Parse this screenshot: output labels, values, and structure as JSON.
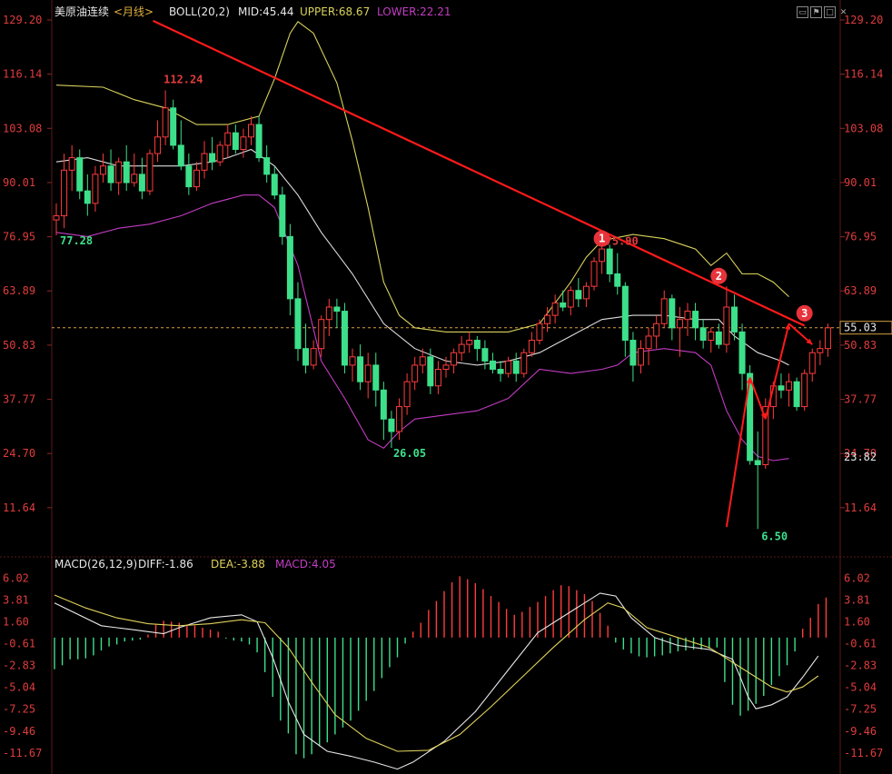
{
  "header": {
    "symbol": "美原油连续",
    "period": "<月线>",
    "boll_label": "BOLL(20,2)",
    "mid_label": "MID:45.44",
    "upper_label": "UPPER:68.67",
    "lower_label": "LOWER:22.21",
    "macd_label": "MACD(26,12,9)",
    "diff_label": "DIFF:-1.86",
    "dea_label": "DEA:-3.88",
    "macd_val_label": "MACD:4.05"
  },
  "toolbar": {
    "icons": [
      "restore-icon",
      "flag-icon",
      "maximize-icon",
      "close-icon"
    ]
  },
  "colors": {
    "up": "#ff3c3c",
    "down": "#3de08a",
    "axis_text": "#e03c3c",
    "price_text": "#e8e8e8",
    "boll_upper": "#d8d25a",
    "boll_mid": "#dcdcdc",
    "boll_lower": "#c33cc3",
    "trend": "#ff1a1a",
    "diff": "#e8e8e8",
    "dea": "#e0d25a",
    "dashed": "#d8a040"
  },
  "chart_data": {
    "type": "candlestick",
    "price_axis": {
      "ticks": [
        "129.20",
        "116.14",
        "103.08",
        "90.01",
        "76.95",
        "63.89",
        "50.83",
        "37.77",
        "24.70",
        "11.64"
      ],
      "ylim": [
        0,
        129.2
      ]
    },
    "macd_axis": {
      "ticks": [
        "6.02",
        "3.81",
        "1.60",
        "-0.61",
        "-2.83",
        "-5.04",
        "-7.25",
        "-9.46",
        "-11.67"
      ],
      "ylim": [
        -13.8,
        6.6
      ]
    },
    "current_price": "55.03",
    "current_value": 55.03,
    "lower_band_value": "23.82",
    "lower_value": 23.82,
    "annotations": {
      "high_1": "112.24",
      "low_1": "77.28",
      "low_2": "26.05",
      "high_2": "75.90",
      "low_3": "6.50"
    },
    "markers": [
      "1",
      "2",
      "3"
    ],
    "candles": [
      [
        81,
        85,
        77.3,
        82
      ],
      [
        82,
        97,
        79,
        93
      ],
      [
        93,
        99,
        88,
        96
      ],
      [
        96,
        98,
        86,
        88
      ],
      [
        88,
        92,
        82,
        85
      ],
      [
        85,
        94,
        83,
        92
      ],
      [
        92,
        97,
        90,
        94
      ],
      [
        94,
        98,
        88,
        90
      ],
      [
        90,
        96,
        87,
        95
      ],
      [
        95,
        99,
        88,
        90
      ],
      [
        90,
        97,
        89,
        92
      ],
      [
        92,
        96,
        86,
        88
      ],
      [
        88,
        98,
        87,
        97
      ],
      [
        97,
        105,
        95,
        101
      ],
      [
        101,
        112.24,
        99,
        108
      ],
      [
        108,
        110,
        98,
        99
      ],
      [
        99,
        105,
        93,
        94
      ],
      [
        94,
        97,
        87,
        89
      ],
      [
        89,
        95,
        88,
        93
      ],
      [
        93,
        100,
        91,
        97
      ],
      [
        97,
        101,
        93,
        95
      ],
      [
        95,
        100,
        94,
        99
      ],
      [
        99,
        104,
        96,
        102
      ],
      [
        102,
        104,
        97,
        98
      ],
      [
        98,
        103,
        96,
        101
      ],
      [
        101,
        106,
        99,
        104
      ],
      [
        104,
        106,
        95,
        96
      ],
      [
        96,
        99,
        90,
        92
      ],
      [
        92,
        94,
        86,
        87
      ],
      [
        87,
        89,
        75,
        77
      ],
      [
        77,
        80,
        58,
        62
      ],
      [
        62,
        66,
        47,
        50
      ],
      [
        50,
        56,
        44,
        46
      ],
      [
        46,
        52,
        45,
        50
      ],
      [
        50,
        58,
        48,
        57
      ],
      [
        57,
        62,
        53,
        60
      ],
      [
        60,
        62,
        55,
        59
      ],
      [
        59,
        61,
        44,
        46
      ],
      [
        46,
        50,
        42,
        48
      ],
      [
        48,
        51,
        40,
        42
      ],
      [
        42,
        49,
        38,
        46
      ],
      [
        46,
        49,
        36,
        40
      ],
      [
        40,
        42,
        28,
        33
      ],
      [
        33,
        35,
        26.05,
        30
      ],
      [
        30,
        38,
        28,
        36
      ],
      [
        36,
        44,
        34,
        42
      ],
      [
        42,
        48,
        40,
        46
      ],
      [
        46,
        50,
        44,
        48
      ],
      [
        48,
        50,
        39,
        41
      ],
      [
        41,
        47,
        39,
        45
      ],
      [
        45,
        48,
        43,
        46
      ],
      [
        46,
        50,
        44,
        49
      ],
      [
        49,
        53,
        47,
        51
      ],
      [
        51,
        54,
        49,
        52
      ],
      [
        52,
        53,
        47,
        50
      ],
      [
        50,
        52,
        45,
        47
      ],
      [
        47,
        49,
        44,
        45
      ],
      [
        45,
        47,
        42,
        44
      ],
      [
        44,
        48,
        43,
        47
      ],
      [
        47,
        49,
        42,
        44
      ],
      [
        44,
        50,
        43,
        49
      ],
      [
        49,
        54,
        48,
        52
      ],
      [
        52,
        57,
        51,
        56
      ],
      [
        56,
        60,
        54,
        58
      ],
      [
        58,
        63,
        56,
        61
      ],
      [
        61,
        64,
        59,
        60
      ],
      [
        60,
        65,
        58,
        64
      ],
      [
        64,
        67,
        60,
        62
      ],
      [
        62,
        66,
        60,
        65
      ],
      [
        65,
        72,
        64,
        71
      ],
      [
        71,
        75.9,
        68,
        74
      ],
      [
        74,
        75,
        66,
        68
      ],
      [
        68,
        73,
        63,
        65
      ],
      [
        65,
        66,
        48,
        52
      ],
      [
        52,
        54,
        42,
        46
      ],
      [
        46,
        52,
        44,
        50
      ],
      [
        50,
        55,
        46,
        53
      ],
      [
        53,
        58,
        50,
        56
      ],
      [
        56,
        64,
        55,
        62
      ],
      [
        62,
        63,
        52,
        55
      ],
      [
        55,
        60,
        48,
        57
      ],
      [
        57,
        61,
        53,
        59
      ],
      [
        59,
        61,
        52,
        55
      ],
      [
        55,
        57,
        50,
        52
      ],
      [
        52,
        55,
        49,
        54
      ],
      [
        54,
        56,
        50,
        51
      ],
      [
        51,
        65,
        49,
        60
      ],
      [
        60,
        63,
        52,
        54
      ],
      [
        54,
        56,
        40,
        44
      ],
      [
        44,
        46,
        22,
        23
      ],
      [
        23,
        30,
        6.5,
        22
      ],
      [
        22,
        38,
        21,
        36
      ],
      [
        36,
        42,
        33,
        41
      ],
      [
        41,
        44,
        38,
        40
      ],
      [
        40,
        44,
        36,
        42
      ],
      [
        42,
        43,
        35,
        36
      ],
      [
        36,
        45,
        35,
        44
      ],
      [
        44,
        50,
        42,
        49
      ],
      [
        49,
        52,
        46,
        50
      ],
      [
        50,
        56,
        48,
        55
      ]
    ],
    "boll": {
      "upper": [
        [
          0,
          113.5
        ],
        [
          6,
          113
        ],
        [
          10,
          110
        ],
        [
          14,
          108
        ],
        [
          18,
          104
        ],
        [
          22,
          104
        ],
        [
          26,
          106
        ],
        [
          28,
          115
        ],
        [
          30,
          126
        ],
        [
          31,
          128.8
        ],
        [
          33,
          126
        ],
        [
          36,
          114
        ],
        [
          38,
          100
        ],
        [
          40,
          84
        ],
        [
          42,
          66
        ],
        [
          44,
          58
        ],
        [
          46,
          55
        ],
        [
          50,
          54
        ],
        [
          54,
          54
        ],
        [
          58,
          54
        ],
        [
          62,
          56
        ],
        [
          66,
          66
        ],
        [
          68,
          72
        ],
        [
          70,
          76
        ],
        [
          74,
          77.5
        ],
        [
          78,
          76.5
        ],
        [
          82,
          74
        ],
        [
          84,
          70
        ],
        [
          86,
          73
        ],
        [
          88,
          68
        ],
        [
          90,
          68
        ],
        [
          92,
          66
        ],
        [
          94,
          62.5
        ]
      ],
      "mid": [
        [
          0,
          95
        ],
        [
          4,
          96
        ],
        [
          8,
          94
        ],
        [
          12,
          94
        ],
        [
          16,
          94
        ],
        [
          20,
          95
        ],
        [
          22,
          96
        ],
        [
          25,
          98
        ],
        [
          28,
          94
        ],
        [
          31,
          87
        ],
        [
          34,
          78
        ],
        [
          38,
          68
        ],
        [
          42,
          56
        ],
        [
          46,
          50
        ],
        [
          50,
          47
        ],
        [
          54,
          46
        ],
        [
          58,
          47
        ],
        [
          62,
          49
        ],
        [
          66,
          53
        ],
        [
          70,
          57
        ],
        [
          74,
          58
        ],
        [
          78,
          58
        ],
        [
          82,
          57
        ],
        [
          85,
          57
        ],
        [
          87,
          53
        ],
        [
          90,
          49
        ],
        [
          93,
          47
        ],
        [
          94,
          46
        ]
      ],
      "lower": [
        [
          0,
          78
        ],
        [
          4,
          77
        ],
        [
          8,
          79
        ],
        [
          12,
          80
        ],
        [
          16,
          82
        ],
        [
          20,
          85
        ],
        [
          24,
          87
        ],
        [
          26,
          87
        ],
        [
          28,
          84
        ],
        [
          31,
          70
        ],
        [
          34,
          47
        ],
        [
          37,
          38
        ],
        [
          40,
          28
        ],
        [
          42,
          26
        ],
        [
          44,
          30
        ],
        [
          46,
          33
        ],
        [
          50,
          34
        ],
        [
          54,
          35
        ],
        [
          58,
          38
        ],
        [
          62,
          45
        ],
        [
          66,
          44
        ],
        [
          70,
          45
        ],
        [
          72,
          46
        ],
        [
          74,
          49
        ],
        [
          78,
          50
        ],
        [
          82,
          49
        ],
        [
          84,
          46
        ],
        [
          86,
          35
        ],
        [
          88,
          28
        ],
        [
          90,
          24
        ],
        [
          92,
          23
        ],
        [
          94,
          23.5
        ]
      ]
    },
    "trendline": [
      [
        6,
        129
      ],
      [
        96,
        55.5
      ]
    ],
    "arrows": [
      [
        [
          86,
          7
        ],
        [
          89,
          43
        ]
      ],
      [
        [
          89,
          43
        ],
        [
          91,
          33
        ]
      ],
      [
        [
          91,
          33
        ],
        [
          94,
          56
        ]
      ],
      [
        [
          94,
          56
        ],
        [
          97,
          51
        ]
      ]
    ],
    "macd_hist": [
      -3.2,
      -2.8,
      -2.2,
      -2.2,
      -2.1,
      -1.8,
      -1.3,
      -0.9,
      -0.7,
      -0.4,
      -0.3,
      -0.2,
      0.3,
      1.3,
      1.7,
      1.6,
      1.5,
      1.3,
      1.2,
      1.0,
      0.8,
      0.6,
      -0.1,
      -0.3,
      -0.4,
      -0.7,
      -1.5,
      -3.5,
      -6.0,
      -8.4,
      -9.7,
      -11.8,
      -12.2,
      -11.8,
      -11.0,
      -10.6,
      -9.8,
      -9.1,
      -8.4,
      -7.4,
      -6.4,
      -5.4,
      -4.1,
      -3.0,
      -2.0,
      -0.6,
      0.6,
      1.5,
      2.8,
      3.7,
      4.7,
      5.6,
      6.2,
      5.9,
      5.5,
      4.9,
      4.2,
      3.6,
      2.9,
      2.3,
      2.6,
      3.1,
      3.6,
      4.2,
      4.8,
      5.3,
      5.2,
      4.8,
      4.4,
      3.7,
      2.5,
      1.2,
      -0.5,
      -1.2,
      -1.6,
      -1.9,
      -2.0,
      -1.9,
      -1.8,
      -1.6,
      -1.4,
      -1.3,
      -1.2,
      -1.2,
      -1.1,
      -1.0,
      -4.5,
      -6.8,
      -7.9,
      -7.4,
      -6.7,
      -5.9,
      -4.8,
      -3.9,
      -2.8,
      -1.4,
      0.9,
      2.0,
      3.4,
      4.05
    ],
    "diff": [
      [
        0,
        3.5
      ],
      [
        6,
        1.2
      ],
      [
        10,
        0.8
      ],
      [
        14,
        0.4
      ],
      [
        16,
        1.0
      ],
      [
        20,
        2.0
      ],
      [
        24,
        2.3
      ],
      [
        26,
        1.6
      ],
      [
        28,
        -2.0
      ],
      [
        30,
        -6.5
      ],
      [
        32,
        -9.8
      ],
      [
        35,
        -11.5
      ],
      [
        38,
        -12.0
      ],
      [
        41,
        -12.6
      ],
      [
        44,
        -13.3
      ],
      [
        46,
        -12.6
      ],
      [
        50,
        -10.5
      ],
      [
        54,
        -7.5
      ],
      [
        58,
        -3.5
      ],
      [
        62,
        0.5
      ],
      [
        66,
        2.5
      ],
      [
        70,
        4.5
      ],
      [
        72,
        4.2
      ],
      [
        74,
        2.0
      ],
      [
        77,
        0.0
      ],
      [
        80,
        -0.8
      ],
      [
        84,
        -1.2
      ],
      [
        87,
        -2.2
      ],
      [
        88,
        -4.0
      ],
      [
        89,
        -6.0
      ],
      [
        90,
        -7.2
      ],
      [
        92,
        -6.8
      ],
      [
        94,
        -6.0
      ],
      [
        96,
        -4.0
      ],
      [
        98,
        -1.86
      ]
    ],
    "dea": [
      [
        0,
        4.3
      ],
      [
        4,
        3.0
      ],
      [
        8,
        2.0
      ],
      [
        12,
        1.4
      ],
      [
        16,
        1.2
      ],
      [
        20,
        1.4
      ],
      [
        24,
        1.8
      ],
      [
        27,
        1.5
      ],
      [
        30,
        -1.0
      ],
      [
        33,
        -4.5
      ],
      [
        36,
        -7.8
      ],
      [
        40,
        -10.2
      ],
      [
        44,
        -11.5
      ],
      [
        48,
        -11.4
      ],
      [
        52,
        -9.8
      ],
      [
        56,
        -7.0
      ],
      [
        60,
        -4.0
      ],
      [
        64,
        -1.0
      ],
      [
        68,
        1.8
      ],
      [
        71,
        3.5
      ],
      [
        73,
        3.0
      ],
      [
        76,
        1.0
      ],
      [
        80,
        0.0
      ],
      [
        84,
        -1.0
      ],
      [
        88,
        -3.0
      ],
      [
        90,
        -4.0
      ],
      [
        92,
        -5.0
      ],
      [
        94,
        -5.5
      ],
      [
        96,
        -5.0
      ],
      [
        98,
        -3.88
      ]
    ]
  }
}
